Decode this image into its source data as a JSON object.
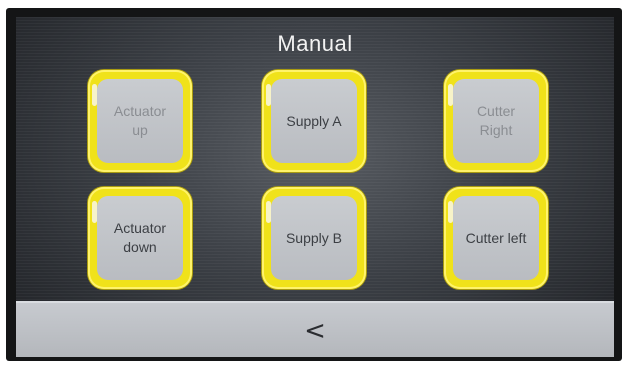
{
  "screen": {
    "title": "Manual"
  },
  "buttons": [
    {
      "id": "actuator-up",
      "label": "Actuator\nup"
    },
    {
      "id": "supply-a",
      "label": "Supply A"
    },
    {
      "id": "cutter-right",
      "label": "Cutter\nRight"
    },
    {
      "id": "actuator-down",
      "label": "Actuator\ndown"
    },
    {
      "id": "supply-b",
      "label": "Supply B"
    },
    {
      "id": "cutter-left",
      "label": "Cutter left"
    }
  ],
  "colors": {
    "tile_border": "#f0e21a",
    "tile_face": "#c2c5c9",
    "background": "#3b3f45"
  },
  "navigation": {
    "back_label": "<"
  }
}
